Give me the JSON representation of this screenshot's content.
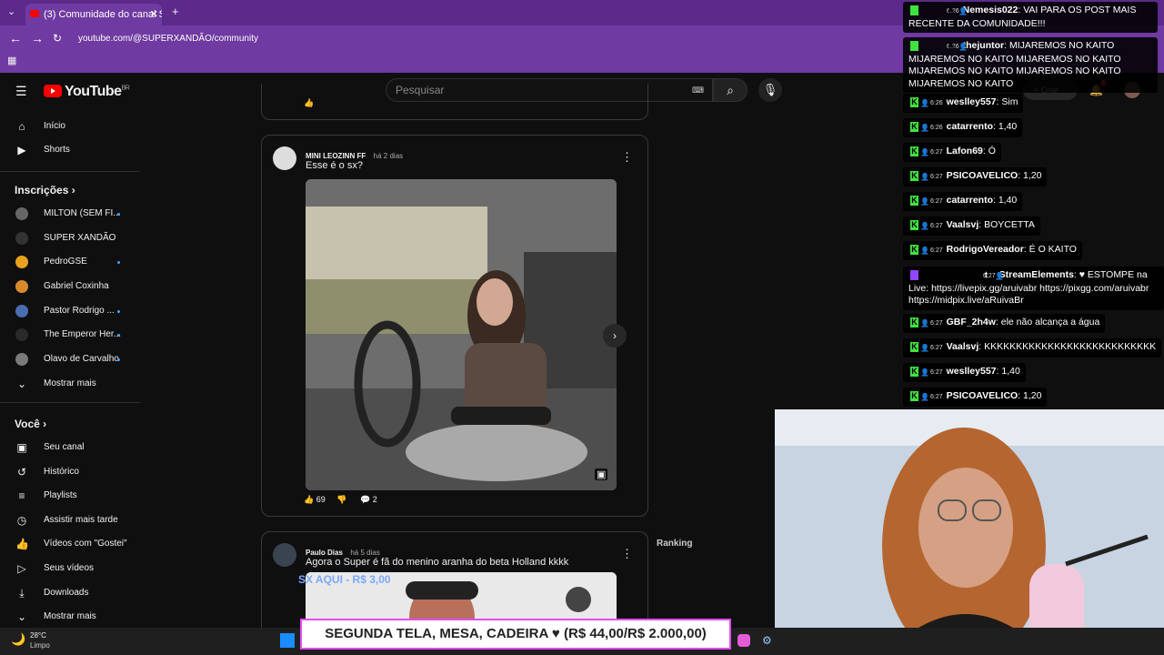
{
  "browser": {
    "tab_title": "(3) Comunidade do canal SUPER",
    "url": "youtube.com/@SUPERXANDÃO/community"
  },
  "youtube": {
    "logo": "YouTube",
    "region": "BR",
    "search_placeholder": "Pesquisar",
    "create_label": "Criar",
    "notif_count": "3"
  },
  "sidebar": {
    "main": [
      {
        "label": "Início",
        "icon": "home-icon"
      },
      {
        "label": "Shorts",
        "icon": "shorts-icon"
      }
    ],
    "subs_title": "Inscrições",
    "subs": [
      {
        "label": "MILTON (SEM FI...",
        "dot": true
      },
      {
        "label": "SUPER XANDÃO",
        "dot": false
      },
      {
        "label": "PedroGSE",
        "dot": true
      },
      {
        "label": "Gabriel Coxinha",
        "dot": false
      },
      {
        "label": "Pastor Rodrigo ...",
        "dot": true
      },
      {
        "label": "The Emperor Her...",
        "dot": true
      },
      {
        "label": "Olavo de Carvalho",
        "dot": true
      }
    ],
    "show_more": "Mostrar mais",
    "you_title": "Você",
    "you": [
      {
        "label": "Seu canal",
        "icon": "channel-icon"
      },
      {
        "label": "Histórico",
        "icon": "history-icon"
      },
      {
        "label": "Playlists",
        "icon": "playlists-icon"
      },
      {
        "label": "Assistir mais tarde",
        "icon": "clock-icon"
      },
      {
        "label": "Vídeos com \"Gostei\"",
        "icon": "like-icon"
      },
      {
        "label": "Seus vídeos",
        "icon": "video-icon"
      },
      {
        "label": "Downloads",
        "icon": "download-icon"
      }
    ],
    "show_more2": "Mostrar mais"
  },
  "posts": [
    {
      "author": "MINI LEOZINN FF",
      "time": "há 2 dias",
      "text": "Esse é o sx?",
      "likes": "69",
      "comments": "2"
    },
    {
      "author": "Paulo Dias",
      "time": "há 5 dias",
      "text": "Agora o Super é fã do menino aranha do beta Holland kkkk"
    }
  ],
  "ranking_label": "Ranking",
  "donation_overlay": "SX AQUI - R$ 3,00",
  "chat": [
    {
      "time": "6:26",
      "user": "Nemesis022",
      "text": "VAI PARA OS POST MAIS RECENTE DA COMUNIDADE!!!"
    },
    {
      "time": "6:26",
      "user": "thejuntor",
      "text": "MIJAREMOS NO KAITO MIJAREMOS NO KAITO MIJAREMOS NO KAITO MIJAREMOS NO KAITO MIJAREMOS NO KAITO MIJAREMOS NO KAITO"
    },
    {
      "time": "6:26",
      "user": "weslley557",
      "text": "Sim"
    },
    {
      "time": "6:26",
      "user": "catarrento",
      "text": "1,40"
    },
    {
      "time": "6:27",
      "user": "Lafon69",
      "text": "Ó"
    },
    {
      "time": "6:27",
      "user": "PSICOAVELICO",
      "text": "1,20"
    },
    {
      "time": "6:27",
      "user": "catarrento",
      "text": "1,40"
    },
    {
      "time": "6:27",
      "user": "Vaalsvj",
      "text": "BOYCETTA"
    },
    {
      "time": "6:27",
      "user": "RodrigoVereador",
      "text": "É O KAITO"
    },
    {
      "time": "6:27",
      "user": "StreamElements",
      "text": "♥ ESTOMPE na Live: https://livepix.gg/aruivabr https://pixgg.com/aruivabr https://midpix.live/aRuivaBr"
    },
    {
      "time": "6:27",
      "user": "GBF_2h4w",
      "text": "ele não alcança a água"
    },
    {
      "time": "6:27",
      "user": "Vaalsvj",
      "text": "KKKKKKKKKKKKKKKKKKKKKKKKKKK"
    },
    {
      "time": "6:27",
      "user": "weslley557",
      "text": "1,40"
    },
    {
      "time": "6:27",
      "user": "PSICOAVELICO",
      "text": "1,20"
    }
  ],
  "banner": "SEGUNDA TELA, MESA, CADEIRA ♥ (R$ 44,00/R$ 2.000,00)",
  "taskbar": {
    "temp": "28°C",
    "weather": "Limpo"
  }
}
